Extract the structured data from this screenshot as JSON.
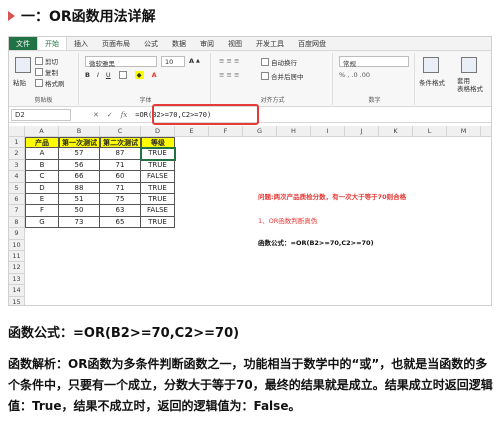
{
  "heading": "一：OR函数用法详解",
  "ribbon": {
    "tabs": [
      "文件",
      "开始",
      "插入",
      "页面布局",
      "公式",
      "数据",
      "审阅",
      "视图",
      "开发工具",
      "百度网盘"
    ],
    "paste": "粘贴",
    "cut": "剪切",
    "copy": "复制",
    "format_painter": "格式刷",
    "clipboard_label": "剪贴板",
    "font_name": "微软雅黑",
    "font_size": "10",
    "font_label": "字体",
    "wrap_text": "自动换行",
    "merge_center": "合并后居中",
    "align_label": "对齐方式",
    "number_format": "常规",
    "number_label": "数字",
    "cond_format": "条件格式",
    "table_format": "套用\n表格格式"
  },
  "formula_bar": {
    "name_box": "D2",
    "cancel": "✕",
    "enter": "✓",
    "fx": "fx",
    "formula": "=OR(B2>=70,C2>=70)"
  },
  "sheet": {
    "columns": [
      "A",
      "B",
      "C",
      "D",
      "E",
      "F",
      "G",
      "H",
      "I",
      "J",
      "K",
      "L",
      "M",
      "N"
    ],
    "rows": [
      "1",
      "2",
      "3",
      "4",
      "5",
      "6",
      "7",
      "8",
      "9",
      "10",
      "11",
      "12",
      "13",
      "14",
      "15"
    ],
    "table_headers": [
      "产品",
      "第一次测试",
      "第二次测试",
      "等级"
    ],
    "table_rows": [
      [
        "A",
        "57",
        "87",
        "TRUE"
      ],
      [
        "B",
        "56",
        "71",
        "TRUE"
      ],
      [
        "C",
        "66",
        "60",
        "FALSE"
      ],
      [
        "D",
        "88",
        "71",
        "TRUE"
      ],
      [
        "E",
        "51",
        "75",
        "TRUE"
      ],
      [
        "F",
        "50",
        "63",
        "FALSE"
      ],
      [
        "G",
        "73",
        "65",
        "TRUE"
      ]
    ],
    "note_question": "问题:两次产品质检分数，有一次大于等于70则合格",
    "note_step": "1、OR函数判断真伪",
    "note_formula": "函数公式：=OR(B2>=70,C2>=70)"
  },
  "body": {
    "formula_line": "函数公式：=OR(B2>=70,C2>=70)",
    "explanation": "函数解析：OR函数为多条件判断函数之一，功能相当于数学中的“或”，也就是当函数的多个条件中，只要有一个成立，分数大于等于70，最终的结果就是成立。结果成立时返回逻辑值：True，结果不成立时，返回的逻辑值为：False。"
  }
}
